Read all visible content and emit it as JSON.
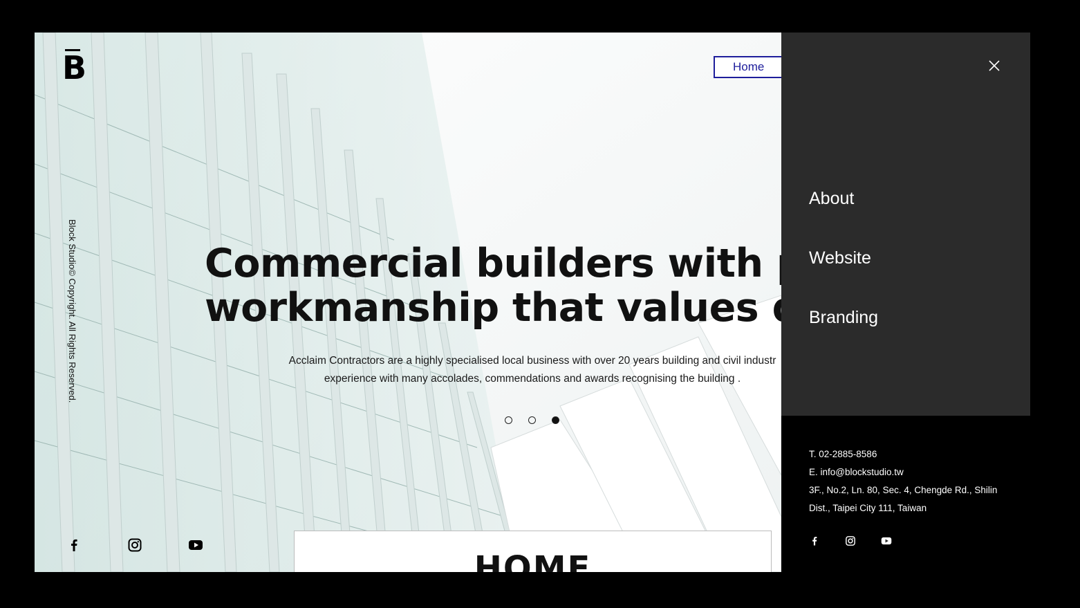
{
  "logo": {
    "letter": "B"
  },
  "sidebar": {
    "copyright": "Block Studio© Copyright. All Rights Reserved."
  },
  "nav": {
    "home_label": "Home"
  },
  "hero": {
    "headline_line1": "Commercial builders with pric",
    "headline_line2": "workmanship that values qua",
    "subtext_line1": "Acclaim Contractors are a highly specialised local business with over 20 years building and civil industr",
    "subtext_line2": "experience with many accolades, commendations and awards recognising the building .",
    "slides": {
      "count": 3,
      "active_index": 2
    }
  },
  "home_card": {
    "title": "HOME"
  },
  "social": {
    "icons": [
      "facebook-icon",
      "instagram-icon",
      "youtube-icon"
    ]
  },
  "menu": {
    "items": [
      {
        "label": "About"
      },
      {
        "label": "Website"
      },
      {
        "label": "Branding"
      }
    ]
  },
  "contact": {
    "phone": "T. 02-2885-8586",
    "email": "E. info@blockstudio.tw",
    "address_line1": "3F., No.2, Ln. 80, Sec. 4, Chengde Rd., Shilin",
    "address_line2": "Dist., Taipei City 111, Taiwan"
  },
  "colors": {
    "menu_panel": "#2b2b2b",
    "nav_accent": "#1d1d9b",
    "background": "#000000"
  }
}
